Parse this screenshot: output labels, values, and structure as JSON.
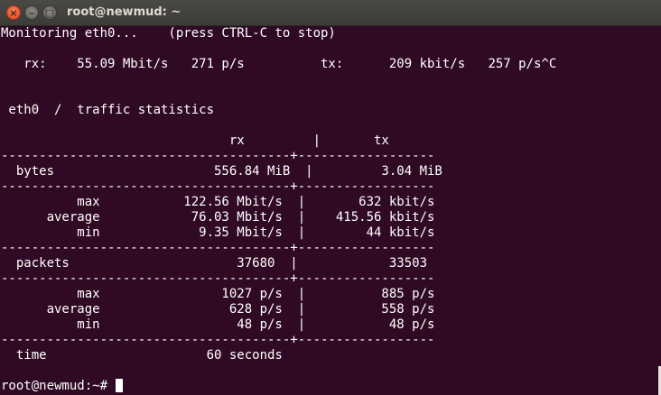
{
  "window": {
    "title": "root@newmud: ~",
    "close_glyph": "×",
    "min_glyph": "–",
    "max_glyph": "□"
  },
  "terminal": {
    "lines": [
      "Monitoring eth0...    (press CTRL-C to stop)",
      "",
      "   rx:    55.09 Mbit/s   271 p/s          tx:      209 kbit/s   257 p/s^C",
      "",
      "",
      " eth0  /  traffic statistics",
      "",
      "                              rx         |       tx",
      "--------------------------------------+------------------",
      "  bytes                     556.84 MiB  |         3.04 MiB",
      "--------------------------------------+------------------",
      "          max           122.56 Mbit/s  |       632 kbit/s",
      "      average            76.03 Mbit/s  |    415.56 kbit/s",
      "          min             9.35 Mbit/s  |        44 kbit/s",
      "--------------------------------------+------------------",
      "  packets                      37680  |            33503",
      "--------------------------------------+------------------",
      "          max                1027 p/s  |          885 p/s",
      "      average                 628 p/s  |          558 p/s",
      "          min                  48 p/s  |           48 p/s",
      "--------------------------------------+------------------",
      "  time                     60 seconds",
      "",
      "root@newmud:~# "
    ]
  }
}
